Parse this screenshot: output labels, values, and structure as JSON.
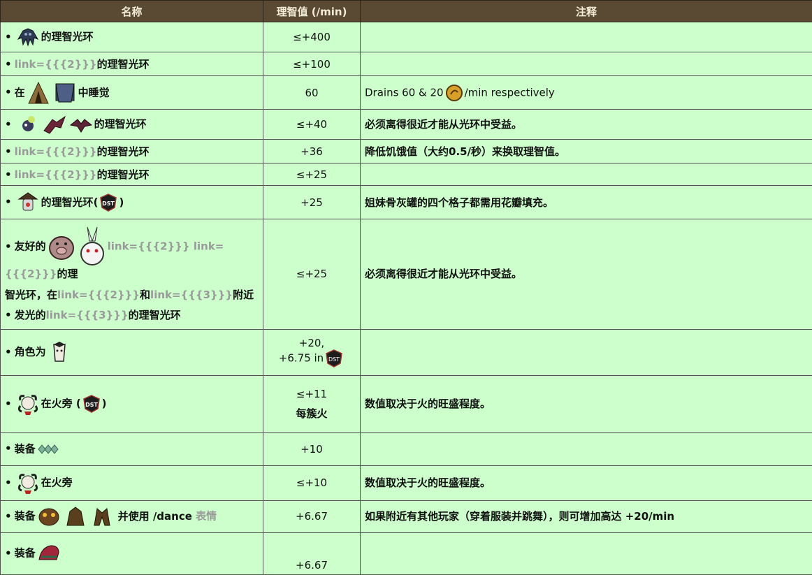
{
  "headers": {
    "name": "名称",
    "value": "理智值 (/min)",
    "note": "注释"
  },
  "rows": [
    {
      "text": "的理智光环",
      "value": "≤+400",
      "note": ""
    },
    {
      "link": "link={{{2}}}",
      "text": "的理智光环",
      "value": "≤+100",
      "note": ""
    },
    {
      "prefix": "在",
      "text": "中睡觉",
      "value": "60",
      "note_a": "Drains 60 & 20",
      "note_b": "/min respectively"
    },
    {
      "text": "的理智光环",
      "value": "≤+40",
      "note": "必须离得很近才能从光环中受益。"
    },
    {
      "link": "link={{{2}}}",
      "text": "的理智光环",
      "value": "+36",
      "note": "降低饥饿值（大约0.5/秒）来换取理智值。"
    },
    {
      "link": "link={{{2}}}",
      "text": "的理智光环",
      "value": "≤+25",
      "note": ""
    },
    {
      "text": "的理智光环(",
      "text_end": ")",
      "value": "+25",
      "note": "姐妹骨灰罐的四个格子都需用花瓣填充。"
    },
    {
      "l1_prefix": "友好的",
      "l1_link_a": "link={{{2}}}",
      "l1_link_b": "link={{{2}}}",
      "l1_suffix": "的理",
      "l2_text_a": "智光环，在",
      "l2_link_a": "link={{{2}}}",
      "l2_and": "和",
      "l2_link_b": "link={{{3}}}",
      "l2_near": "附近",
      "l3_prefix": "发光的",
      "l3_link": "link={{{3}}}",
      "l3_suffix": "的理智光环",
      "value": "≤+25",
      "note": "必须离得很近才能从光环中受益。"
    },
    {
      "prefix": "角色为",
      "value_a": "+20,",
      "value_b": "+6.75 in",
      "note": ""
    },
    {
      "text": "在火旁 (",
      "text_end": ")",
      "value_a": "≤+11",
      "value_b": "每簇火",
      "note": "数值取决于火的旺盛程度。"
    },
    {
      "prefix": "装备",
      "value": "+10",
      "note": ""
    },
    {
      "text": "在火旁",
      "value": "≤+10",
      "note": "数值取决于火的旺盛程度。"
    },
    {
      "prefix": "装备",
      "text": "并使用 /dance",
      "link": "表情",
      "value": "+6.67",
      "note": "如果附近有其他玩家（穿着服装并跳舞），则可增加高达 +20/min"
    },
    {
      "prefix": "装备",
      "value": "+6.67",
      "note": ""
    }
  ],
  "colors": {
    "header_bg": "#5a4a33",
    "header_text": "#f3ecd7",
    "cell_bg": "#ccffcc",
    "link": "#9a9a9a"
  }
}
